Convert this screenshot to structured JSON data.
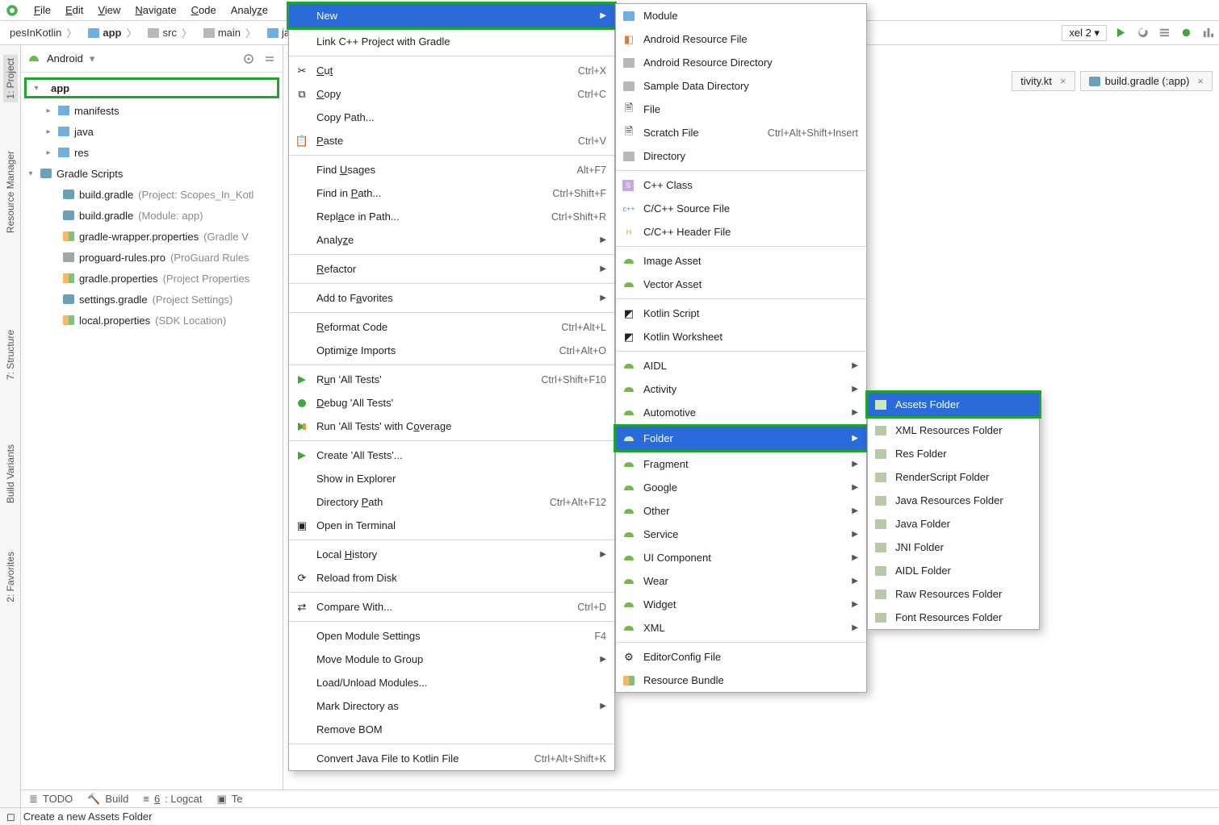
{
  "menubar": {
    "file": "File",
    "edit": "Edit",
    "view": "View",
    "navigate": "Navigate",
    "code": "Code",
    "analyze": "Analyze"
  },
  "crumbs": {
    "root": "pesInKotlin",
    "app": "app",
    "src": "src",
    "main": "main",
    "java": "java"
  },
  "device": "xel 2 ▾",
  "tabs": {
    "activity": "tivity.kt",
    "gradle": "build.gradle (:app)"
  },
  "leftStripe": {
    "project": "1: Project",
    "resmgr": "Resource Manager",
    "structure": "7: Structure",
    "variants": "Build Variants",
    "favorites": "2: Favorites"
  },
  "projectHeader": "Android",
  "tree": {
    "app": "app",
    "manifests": "manifests",
    "java": "java",
    "res": "res",
    "gradleScripts": "Gradle Scripts",
    "bgProject": "build.gradle",
    "bgProjectHint": "(Project: Scopes_In_Kotl",
    "bgModule": "build.gradle",
    "bgModuleHint": "(Module: app)",
    "gw": "gradle-wrapper.properties",
    "gwHint": "(Gradle V",
    "pg": "proguard-rules.pro",
    "pgHint": "(ProGuard Rules",
    "gp": "gradle.properties",
    "gpHint": "(Project Properties",
    "sg": "settings.gradle",
    "sgHint": "(Project Settings)",
    "lp": "local.properties",
    "lpHint": "(SDK Location)"
  },
  "ctx1": {
    "new": "New",
    "linkcpp": "Link C++ Project with Gradle",
    "cut": "Cut",
    "cut_sc": "Ctrl+X",
    "copy": "Copy",
    "copy_sc": "Ctrl+C",
    "copypath": "Copy Path...",
    "paste": "Paste",
    "paste_sc": "Ctrl+V",
    "findusages": "Find Usages",
    "findusages_sc": "Alt+F7",
    "findinpath": "Find in Path...",
    "findinpath_sc": "Ctrl+Shift+F",
    "replaceinpath": "Replace in Path...",
    "replaceinpath_sc": "Ctrl+Shift+R",
    "analyze": "Analyze",
    "refactor": "Refactor",
    "addfav": "Add to Favorites",
    "reformat": "Reformat Code",
    "reformat_sc": "Ctrl+Alt+L",
    "optimize": "Optimize Imports",
    "optimize_sc": "Ctrl+Alt+O",
    "run": "Run 'All Tests'",
    "run_sc": "Ctrl+Shift+F10",
    "debug": "Debug 'All Tests'",
    "runcov": "Run 'All Tests' with Coverage",
    "create": "Create 'All Tests'...",
    "showexp": "Show in Explorer",
    "dirpath": "Directory Path",
    "dirpath_sc": "Ctrl+Alt+F12",
    "term": "Open in Terminal",
    "localhist": "Local History",
    "reload": "Reload from Disk",
    "compare": "Compare With...",
    "compare_sc": "Ctrl+D",
    "openmod": "Open Module Settings",
    "openmod_sc": "F4",
    "movemod": "Move Module to Group",
    "loadmod": "Load/Unload Modules...",
    "markdir": "Mark Directory as",
    "removebom": "Remove BOM",
    "convert": "Convert Java File to Kotlin File",
    "convert_sc": "Ctrl+Alt+Shift+K"
  },
  "ctx2": {
    "module": "Module",
    "ard": "Android Resource File",
    "ardir": "Android Resource Directory",
    "sdd": "Sample Data Directory",
    "file": "File",
    "scratch": "Scratch File",
    "scratch_sc": "Ctrl+Alt+Shift+Insert",
    "directory": "Directory",
    "cppclass": "C++ Class",
    "cppsrc": "C/C++ Source File",
    "cpphdr": "C/C++ Header File",
    "imageasset": "Image Asset",
    "vectorasset": "Vector Asset",
    "kotlinscript": "Kotlin Script",
    "kotlinws": "Kotlin Worksheet",
    "aidl": "AIDL",
    "activity": "Activity",
    "automotive": "Automotive",
    "folder": "Folder",
    "fragment": "Fragment",
    "google": "Google",
    "other": "Other",
    "service": "Service",
    "uicomponent": "UI Component",
    "wear": "Wear",
    "widget": "Widget",
    "xml": "XML",
    "editorconfig": "EditorConfig File",
    "resourcebundle": "Resource Bundle"
  },
  "ctx3": {
    "assets": "Assets Folder",
    "xmlres": "XML Resources Folder",
    "res": "Res Folder",
    "rs": "RenderScript Folder",
    "javares": "Java Resources Folder",
    "javaf": "Java Folder",
    "jni": "JNI Folder",
    "aidl": "AIDL Folder",
    "rawres": "Raw Resources Folder",
    "fontres": "Font Resources Folder"
  },
  "bottom": {
    "todo": "TODO",
    "build": "Build",
    "logcat": "6: Logcat",
    "term": "Te"
  },
  "status": "Create a new Assets Folder"
}
